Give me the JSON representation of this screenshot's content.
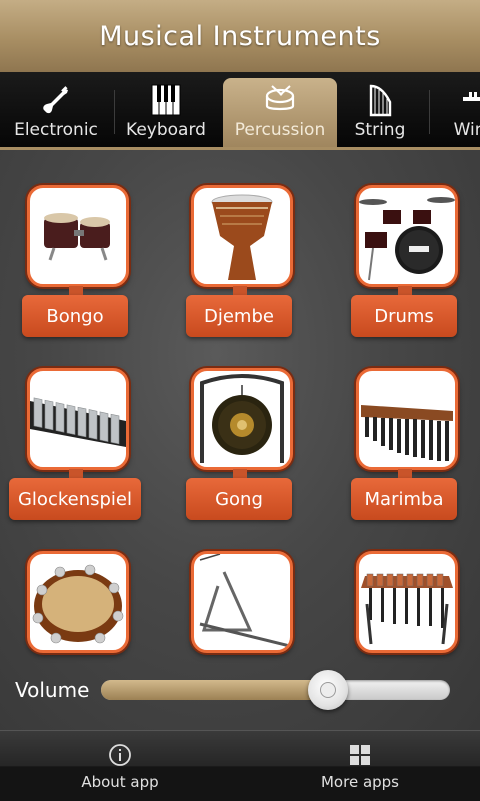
{
  "header": {
    "title": "Musical Instruments"
  },
  "tabs": [
    {
      "label": "Electronic",
      "icon": "electric-guitar-icon",
      "active": false
    },
    {
      "label": "Keyboard",
      "icon": "piano-keys-icon",
      "active": false
    },
    {
      "label": "Percussion",
      "icon": "drum-icon",
      "active": true
    },
    {
      "label": "String",
      "icon": "harp-icon",
      "active": false
    },
    {
      "label": "Wind",
      "icon": "trumpet-icon",
      "active": false
    }
  ],
  "instruments": [
    {
      "label": "Bongo"
    },
    {
      "label": "Djembe"
    },
    {
      "label": "Drums"
    },
    {
      "label": "Glockenspiel"
    },
    {
      "label": "Gong"
    },
    {
      "label": "Marimba"
    },
    {
      "label": "Tambourine"
    },
    {
      "label": "Triangle"
    },
    {
      "label": "Xylophone"
    }
  ],
  "volume": {
    "label": "Volume",
    "level_percent": 65
  },
  "bottom_bar": {
    "about": {
      "label": "About app",
      "icon": "info-icon"
    },
    "more": {
      "label": "More apps",
      "icon": "grid-icon"
    }
  },
  "colors": {
    "accent": "#e8693a",
    "header": "#a88e63"
  }
}
